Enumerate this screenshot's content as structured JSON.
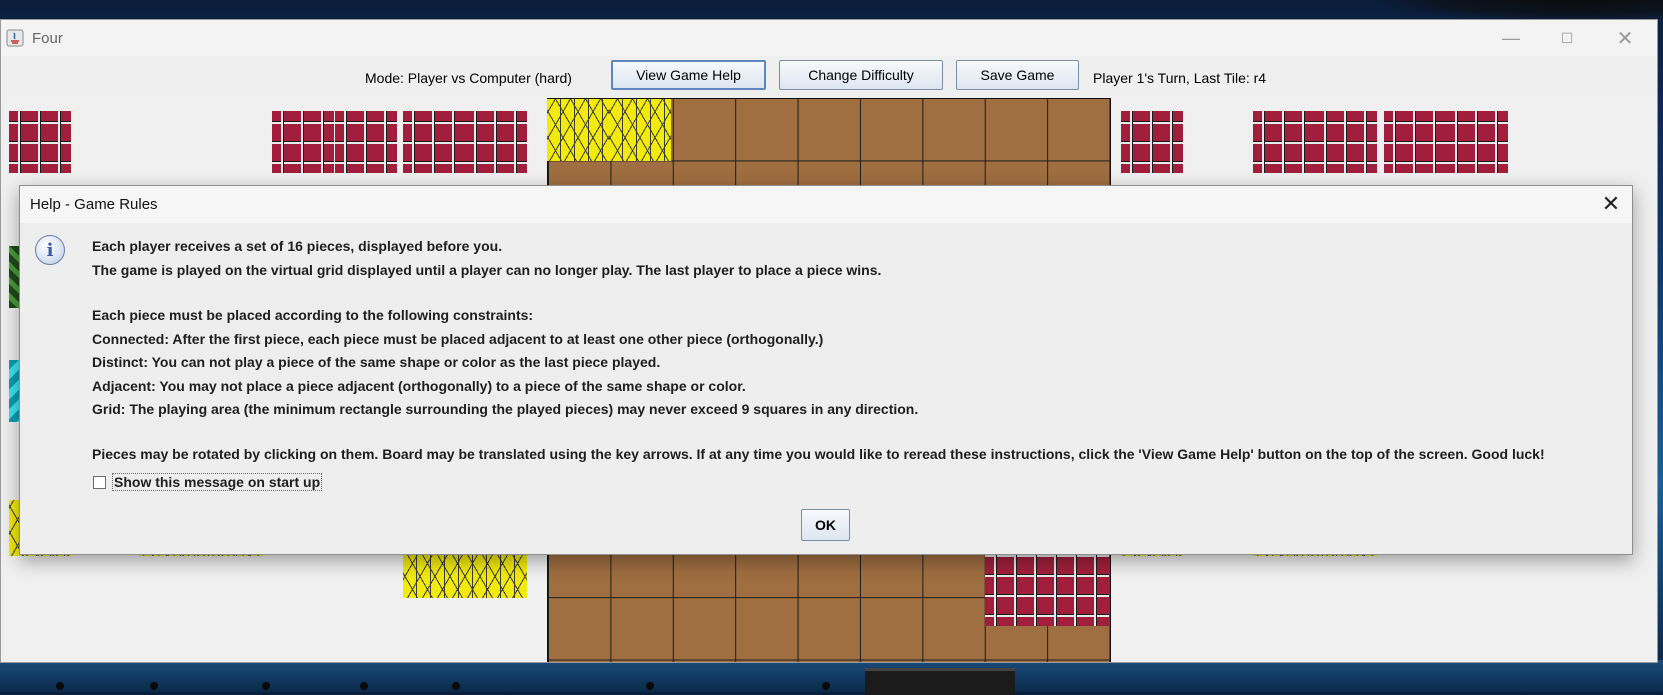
{
  "window": {
    "title": "Four",
    "controls": {
      "minimize": "—",
      "maximize": "☐",
      "close": "✕"
    }
  },
  "toolbar": {
    "mode": "Mode: Player vs Computer (hard)",
    "view_help": "View Game Help",
    "change_difficulty": "Change Difficulty",
    "save_game": "Save Game",
    "turn_status": "Player 1's Turn, Last Tile: r4"
  },
  "game": {
    "tile_colors": {
      "red": "#a11f3c",
      "yellow": "#f2ea0a",
      "green": "#2f6b2c",
      "cyan": "#16c9da"
    },
    "board_color": "#9f6e41"
  },
  "dialog": {
    "title": "Help - Game Rules",
    "close": "✕",
    "icon": "info-icon",
    "icon_glyph": "i",
    "lines": [
      "Each player receives a set of 16 pieces, displayed before you.",
      "The game is played on the virtual grid displayed until a player can no longer play. The last player to place a piece wins.",
      "Each piece must be placed according to the following constraints:",
      "Connected: After the first piece, each piece must be placed adjacent to at least one other piece (orthogonally.)",
      "Distinct: You can not play a piece of the same shape or color as the last piece played.",
      "Adjacent: You may not place a piece adjacent (orthogonally) to a piece of the same shape or color.",
      "Grid: The playing area (the minimum rectangle surrounding the played pieces) may never exceed 9 squares in any direction.",
      "Pieces may be rotated by clicking on them. Board may be translated using the key arrows. If at any time you would like to reread these instructions, click the 'View Game Help' button on the top of the screen. Good luck!"
    ],
    "checkbox_label": "Show this message on start up",
    "checkbox_checked": false,
    "ok": "OK"
  }
}
